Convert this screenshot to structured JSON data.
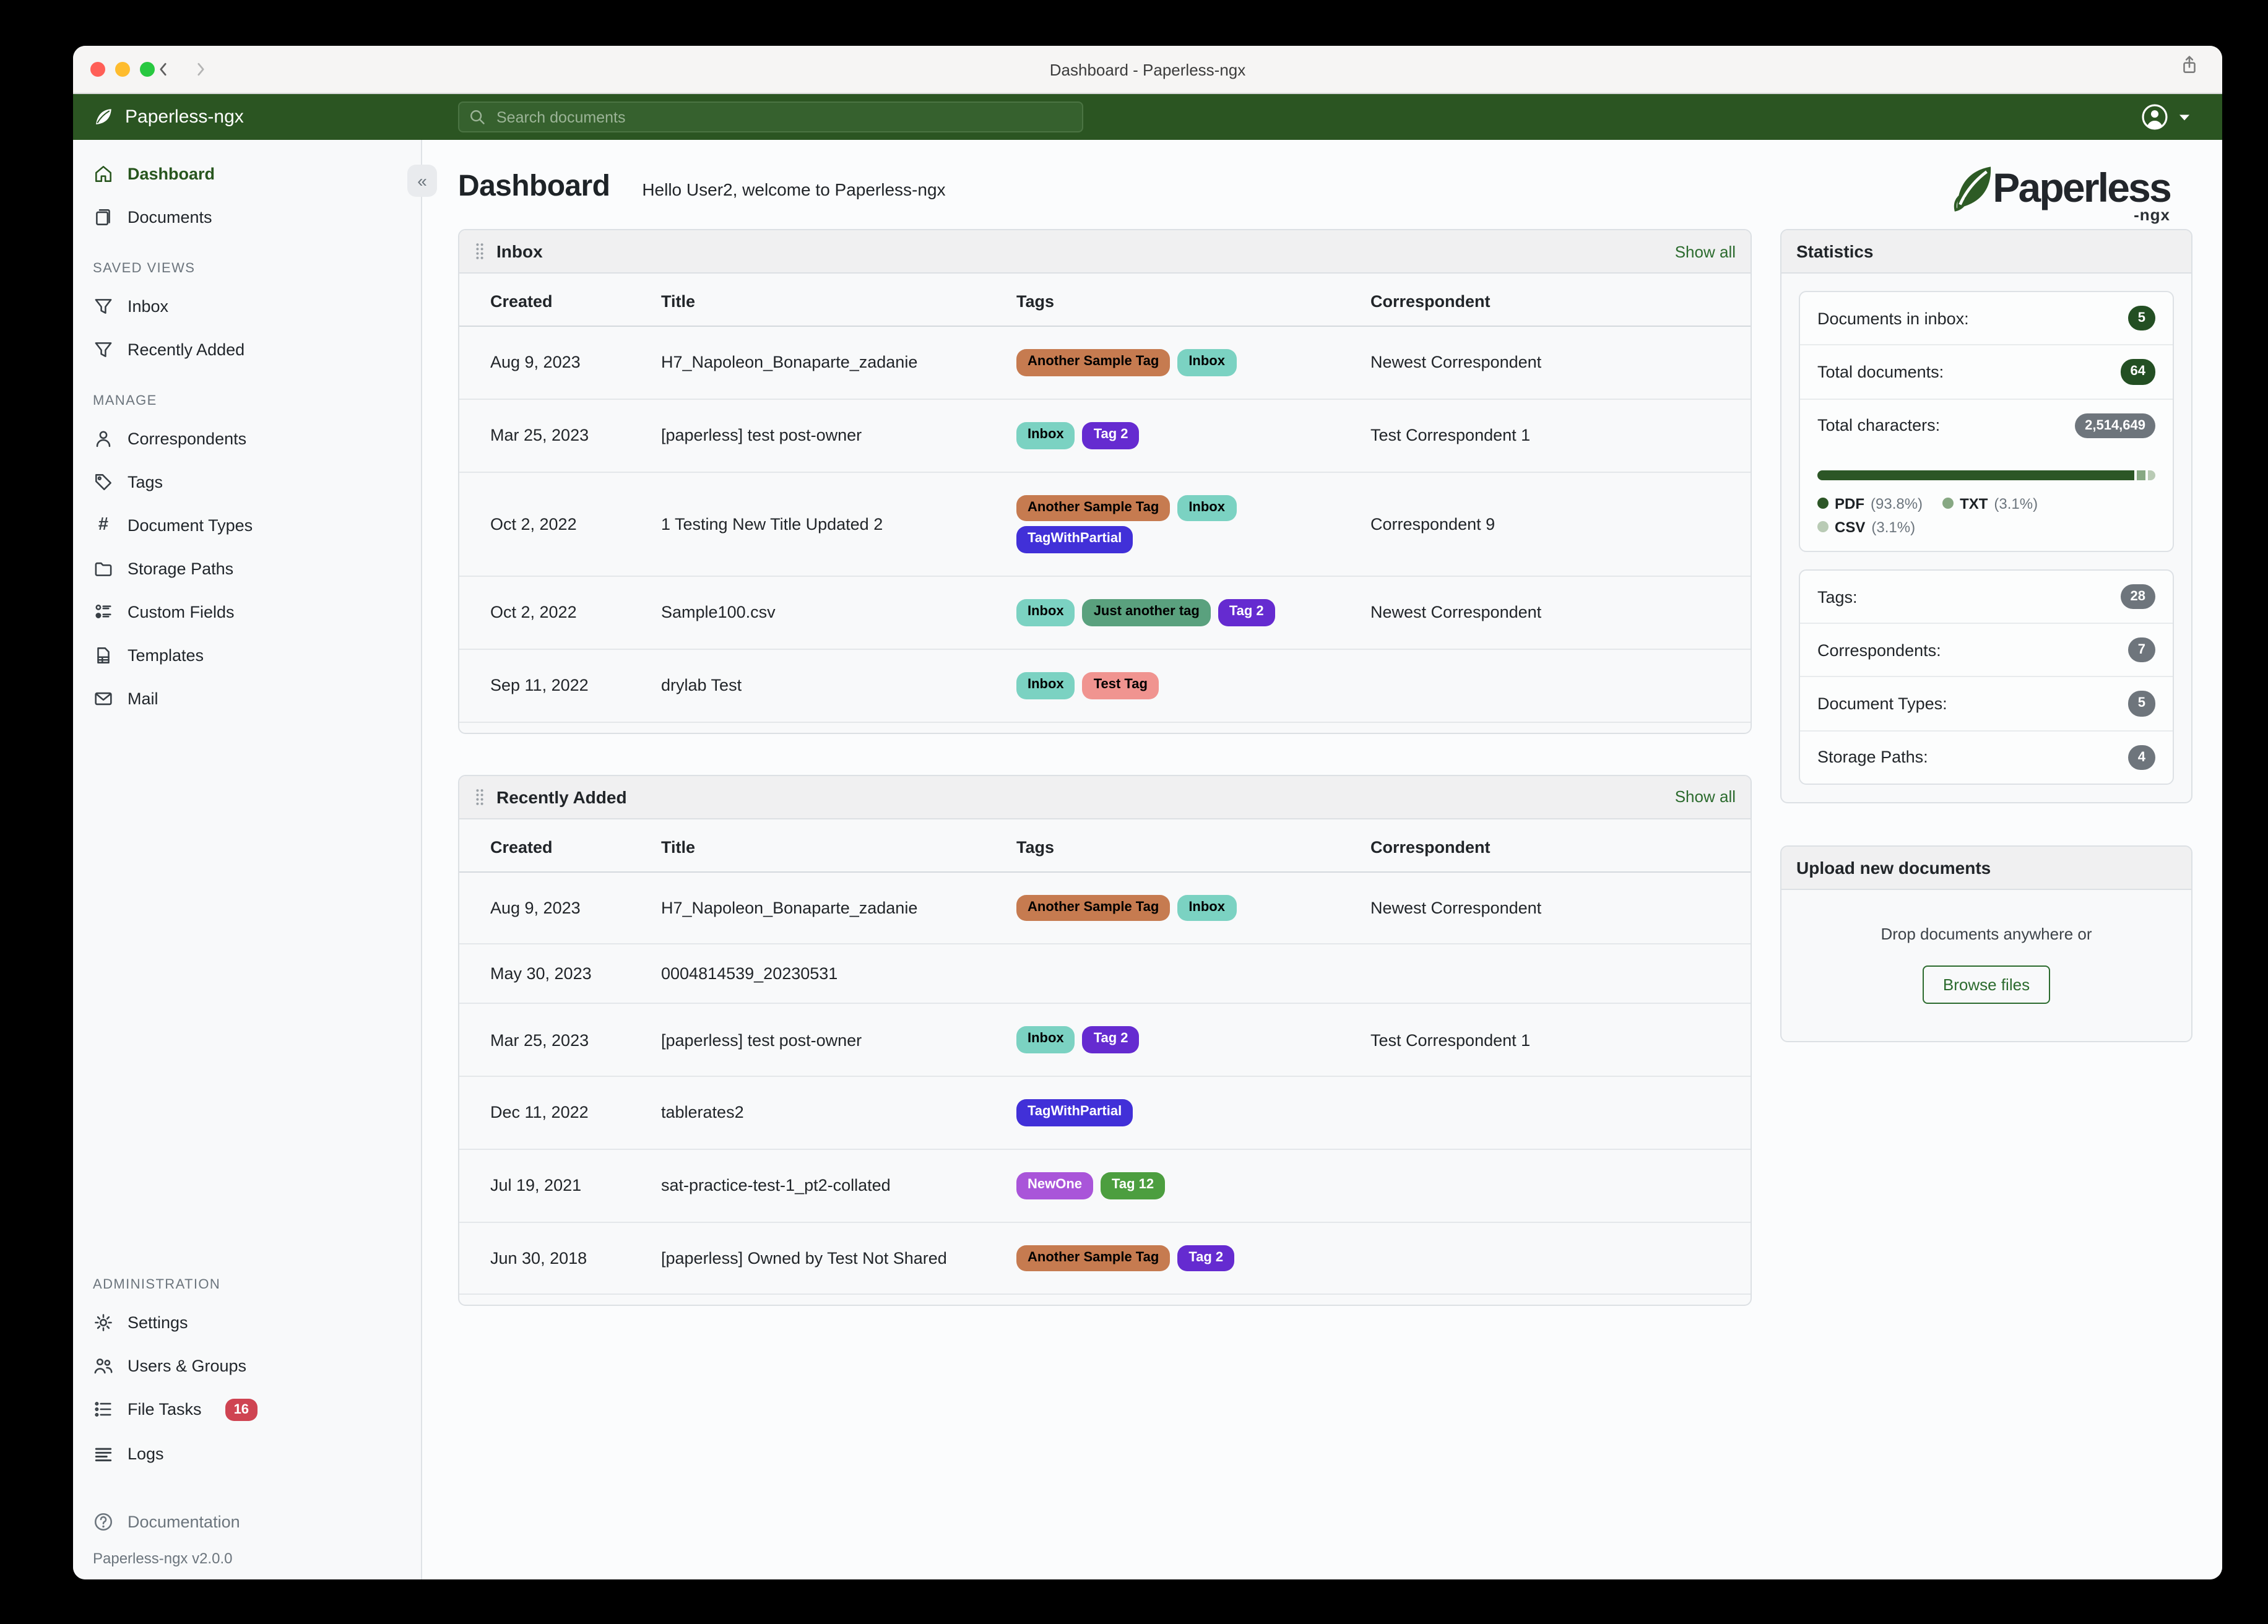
{
  "window": {
    "title": "Dashboard - Paperless-ngx"
  },
  "topbar": {
    "brand": "Paperless-ngx",
    "search": {
      "placeholder": "Search documents"
    }
  },
  "sidebar": {
    "primary": [
      {
        "label": "Dashboard",
        "icon": "home-icon",
        "active": true
      },
      {
        "label": "Documents",
        "icon": "documents-icon"
      }
    ],
    "sections": [
      {
        "heading": "SAVED VIEWS",
        "items": [
          {
            "label": "Inbox",
            "icon": "filter-icon"
          },
          {
            "label": "Recently Added",
            "icon": "filter-icon"
          }
        ]
      },
      {
        "heading": "MANAGE",
        "items": [
          {
            "label": "Correspondents",
            "icon": "person-icon"
          },
          {
            "label": "Tags",
            "icon": "tag-icon"
          },
          {
            "label": "Document Types",
            "icon": "hash-icon"
          },
          {
            "label": "Storage Paths",
            "icon": "folder-icon"
          },
          {
            "label": "Custom Fields",
            "icon": "custom-fields-icon"
          },
          {
            "label": "Templates",
            "icon": "template-icon"
          },
          {
            "label": "Mail",
            "icon": "mail-icon"
          }
        ]
      },
      {
        "heading": "ADMINISTRATION",
        "items": [
          {
            "label": "Settings",
            "icon": "gear-icon"
          },
          {
            "label": "Users & Groups",
            "icon": "users-icon"
          },
          {
            "label": "File Tasks",
            "icon": "tasks-icon",
            "badge": "16"
          },
          {
            "label": "Logs",
            "icon": "logs-icon"
          }
        ]
      }
    ],
    "documentation": "Documentation",
    "version": "Paperless-ngx v2.0.0"
  },
  "content": {
    "title": "Dashboard",
    "greeting": "Hello User2, welcome to Paperless-ngx",
    "logo": {
      "word": "Paperless",
      "suffix": "-ngx"
    }
  },
  "tag_styles": {
    "Another Sample Tag": {
      "bg": "#c67b50",
      "fg": "#000000"
    },
    "Inbox": {
      "bg": "#7bd2c2",
      "fg": "#000000"
    },
    "Tag 2": {
      "bg": "#652bd0",
      "fg": "#ffffff"
    },
    "TagWithPartial": {
      "bg": "#4130d8",
      "fg": "#ffffff"
    },
    "Just another tag": {
      "bg": "#5aa17e",
      "fg": "#000000"
    },
    "Test Tag": {
      "bg": "#f09490",
      "fg": "#000000"
    },
    "NewOne": {
      "bg": "#a955d9",
      "fg": "#ffffff"
    },
    "Tag 12": {
      "bg": "#4c9e3f",
      "fg": "#ffffff"
    }
  },
  "widgets": {
    "inbox": {
      "title": "Inbox",
      "show_all": "Show all",
      "columns": [
        "Created",
        "Title",
        "Tags",
        "Correspondent"
      ],
      "rows": [
        {
          "created": "Aug 9, 2023",
          "title": "H7_Napoleon_Bonaparte_zadanie",
          "tags": [
            "Another Sample Tag",
            "Inbox"
          ],
          "correspondent": "Newest Correspondent"
        },
        {
          "created": "Mar 25, 2023",
          "title": "[paperless] test post-owner",
          "tags": [
            "Inbox",
            "Tag 2"
          ],
          "correspondent": "Test Correspondent 1"
        },
        {
          "created": "Oct 2, 2022",
          "title": "1 Testing New Title Updated 2",
          "tags": [
            "Another Sample Tag",
            "Inbox",
            "TagWithPartial"
          ],
          "correspondent": "Correspondent 9"
        },
        {
          "created": "Oct 2, 2022",
          "title": "Sample100.csv",
          "tags": [
            "Inbox",
            "Just another tag",
            "Tag 2"
          ],
          "correspondent": "Newest Correspondent"
        },
        {
          "created": "Sep 11, 2022",
          "title": "drylab Test",
          "tags": [
            "Inbox",
            "Test Tag"
          ],
          "correspondent": ""
        }
      ]
    },
    "recent": {
      "title": "Recently Added",
      "show_all": "Show all",
      "columns": [
        "Created",
        "Title",
        "Tags",
        "Correspondent"
      ],
      "rows": [
        {
          "created": "Aug 9, 2023",
          "title": "H7_Napoleon_Bonaparte_zadanie",
          "tags": [
            "Another Sample Tag",
            "Inbox"
          ],
          "correspondent": "Newest Correspondent"
        },
        {
          "created": "May 30, 2023",
          "title": "0004814539_20230531",
          "tags": [],
          "correspondent": ""
        },
        {
          "created": "Mar 25, 2023",
          "title": "[paperless] test post-owner",
          "tags": [
            "Inbox",
            "Tag 2"
          ],
          "correspondent": "Test Correspondent 1"
        },
        {
          "created": "Dec 11, 2022",
          "title": "tablerates2",
          "tags": [
            "TagWithPartial"
          ],
          "correspondent": ""
        },
        {
          "created": "Jul 19, 2021",
          "title": "sat-practice-test-1_pt2-collated",
          "tags": [
            "NewOne",
            "Tag 12"
          ],
          "correspondent": ""
        },
        {
          "created": "Jun 30, 2018",
          "title": "[paperless] Owned by Test Not Shared",
          "tags": [
            "Another Sample Tag",
            "Tag 2"
          ],
          "correspondent": ""
        }
      ]
    }
  },
  "statistics": {
    "title": "Statistics",
    "document_rows": [
      {
        "label": "Documents in inbox:",
        "value": "5",
        "style": "green"
      },
      {
        "label": "Total documents:",
        "value": "64",
        "style": "green"
      },
      {
        "label": "Total characters:",
        "value": "2,514,649",
        "style": "gray"
      }
    ],
    "file_types": [
      {
        "name": "PDF",
        "pct": "93.8",
        "color": "#2c5626"
      },
      {
        "name": "TXT",
        "pct": "3.1",
        "color": "#87a883"
      },
      {
        "name": "CSV",
        "pct": "3.1",
        "color": "#b9cbb5"
      }
    ],
    "object_rows": [
      {
        "label": "Tags:",
        "value": "28",
        "style": "gray"
      },
      {
        "label": "Correspondents:",
        "value": "7",
        "style": "gray"
      },
      {
        "label": "Document Types:",
        "value": "5",
        "style": "gray"
      },
      {
        "label": "Storage Paths:",
        "value": "4",
        "style": "gray"
      }
    ]
  },
  "upload": {
    "title": "Upload new documents",
    "hint": "Drop documents anywhere or",
    "button": "Browse files"
  }
}
